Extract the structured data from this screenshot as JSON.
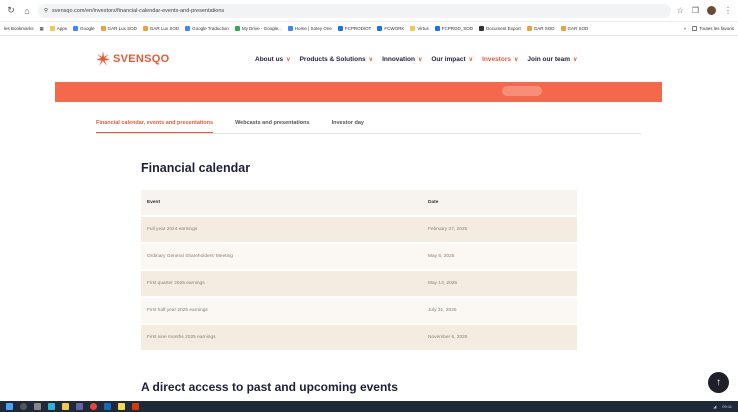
{
  "browser": {
    "url": "svensqo.com/en/investors/financial-calendar-events-and-presentations",
    "bookmarks_label": "Toutes les favoris",
    "bookmarks": [
      "Apps",
      "Google",
      "GAR Lux SOD",
      "GAR Lux SOD",
      "Google Traduction",
      "My Drive - Google...",
      "Home | Sotey One",
      "FCPRODIOT",
      "FCWORK",
      "Virtus",
      "FCPROD_SOD",
      "Document Export",
      "GAR SOD",
      "GAR SOD"
    ],
    "left_label": "les Bookmarks"
  },
  "site": {
    "brand": "SVENSQO",
    "nav": [
      {
        "label": "About us",
        "active": false
      },
      {
        "label": "Products & Solutions",
        "active": false
      },
      {
        "label": "Innovation",
        "active": false
      },
      {
        "label": "Our impact",
        "active": false
      },
      {
        "label": "Investors",
        "active": true
      },
      {
        "label": "Join our team",
        "active": false
      }
    ],
    "accent_color": "#e85a36",
    "banner_color": "#f4694b"
  },
  "tabs": [
    {
      "label": "Financial calendar, events and presentations",
      "active": true
    },
    {
      "label": "Webcasts and presentations",
      "active": false
    },
    {
      "label": "Investor day",
      "active": false
    }
  ],
  "calendar": {
    "title": "Financial calendar",
    "headers": {
      "event": "Event",
      "date": "Date"
    },
    "rows": [
      {
        "event": "Full year 2024 earnings",
        "date": "February 27, 2025"
      },
      {
        "event": "Ordinary General Shareholders' Meeting",
        "date": "May 6, 2025"
      },
      {
        "event": "First quarter 2025 earnings",
        "date": "May 13, 2025"
      },
      {
        "event": "First half year 2025 earnings",
        "date": "July 31, 2025"
      },
      {
        "event": "First nine months 2025 earnings",
        "date": "November 6, 2025"
      }
    ]
  },
  "access_title": "A direct access to past and upcoming events",
  "taskbar": {
    "time": "09:11"
  }
}
